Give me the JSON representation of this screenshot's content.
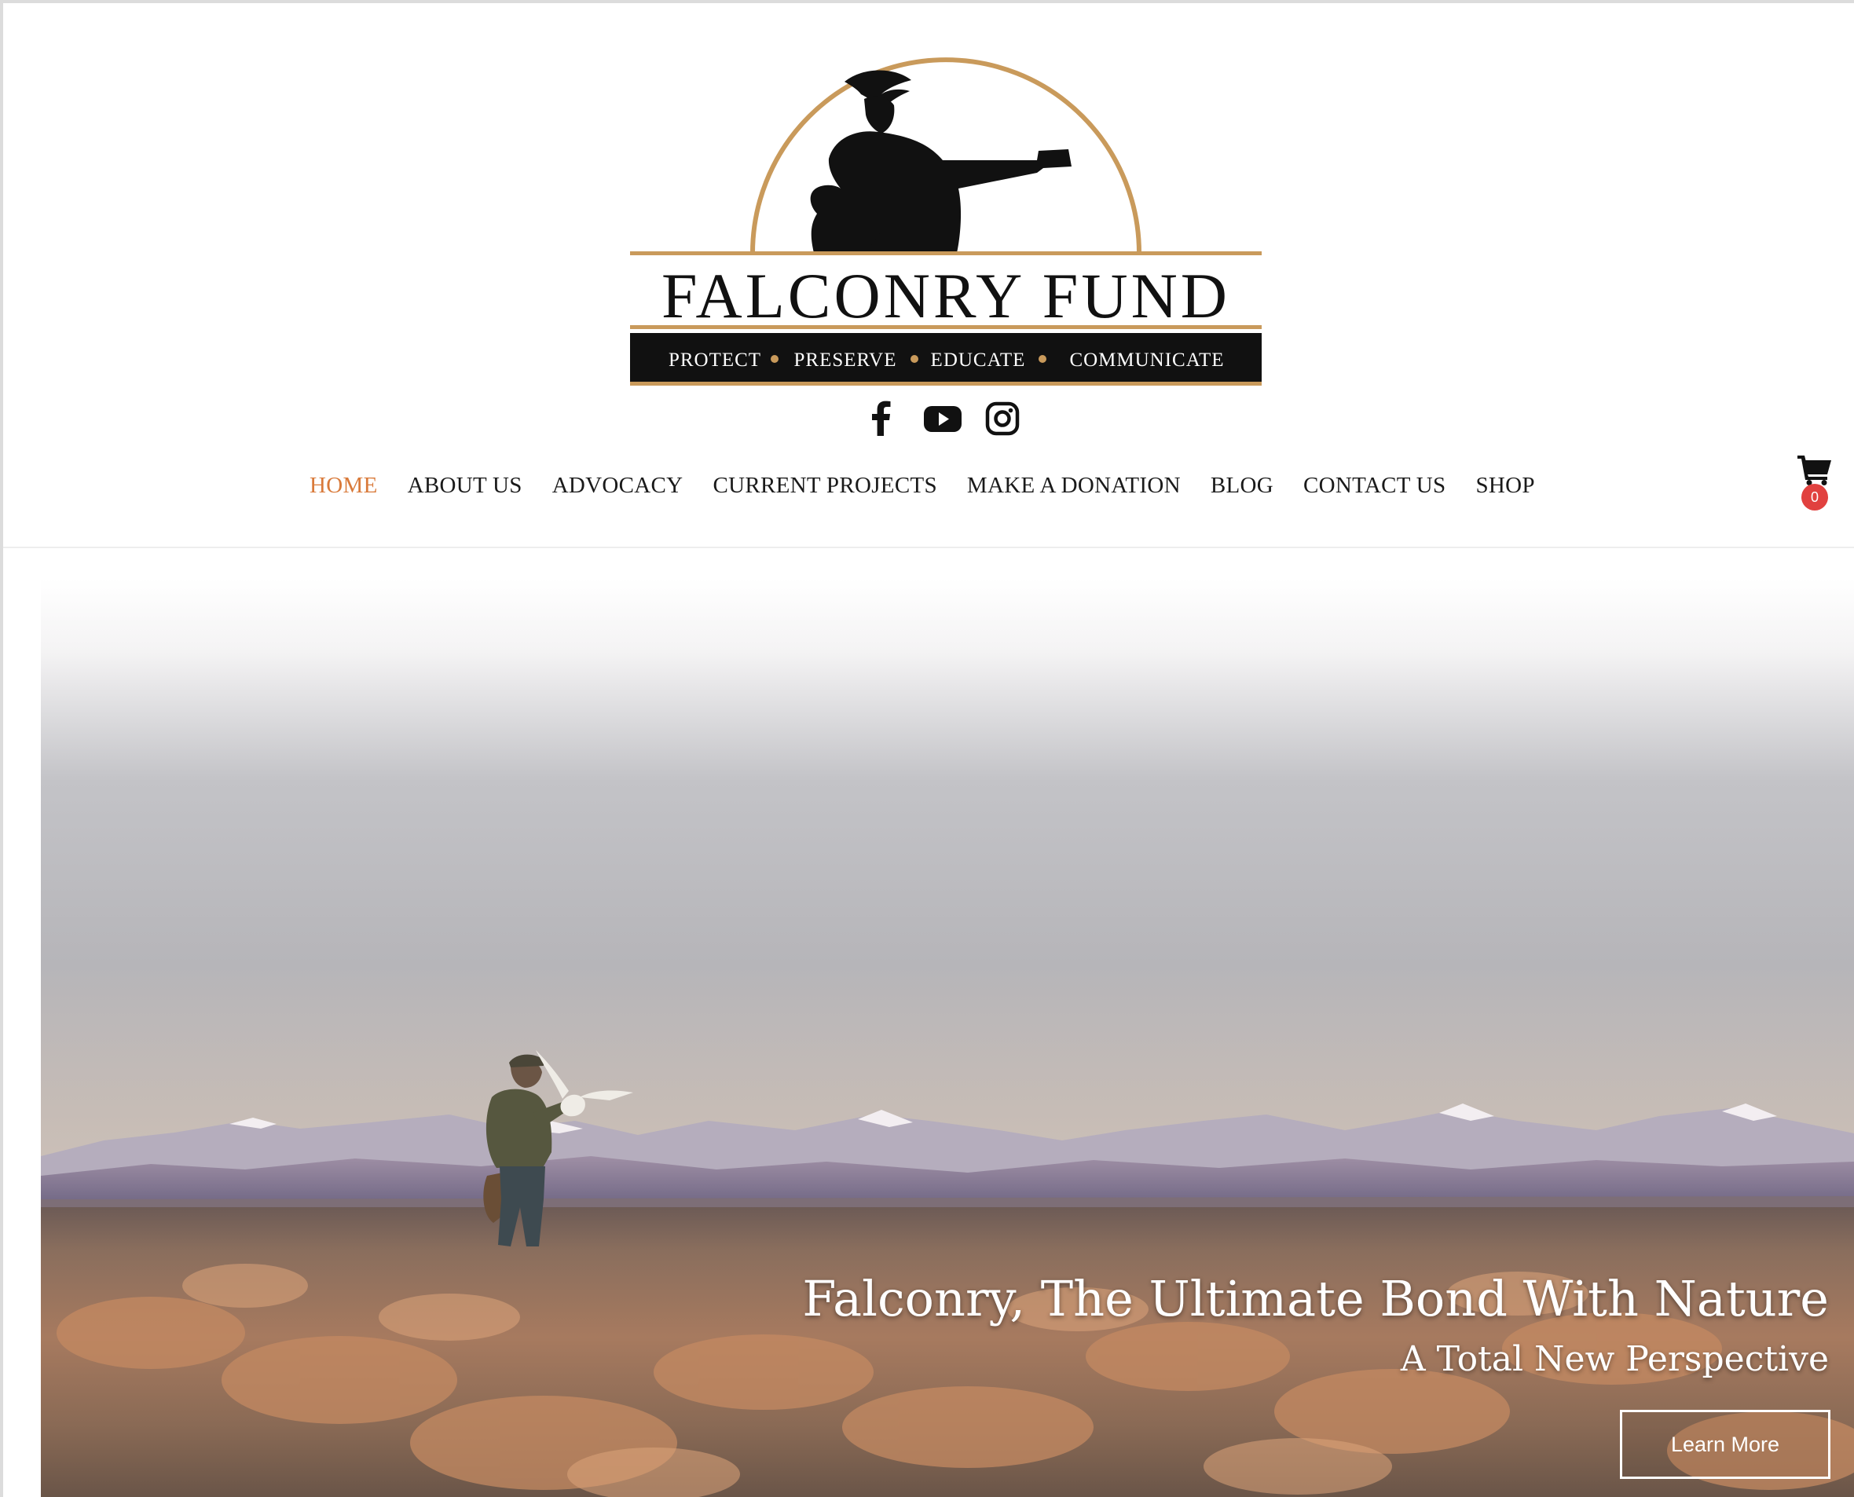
{
  "brand": {
    "name": "FALCONRY FUND",
    "tagline_items": [
      "PROTECT",
      "PRESERVE",
      "EDUCATE",
      "COMMUNICATE"
    ],
    "gold": "#c99a5b",
    "dark": "#111111"
  },
  "social": [
    {
      "name": "facebook",
      "icon": "facebook-icon"
    },
    {
      "name": "youtube",
      "icon": "youtube-icon"
    },
    {
      "name": "instagram",
      "icon": "instagram-icon"
    }
  ],
  "nav": {
    "items": [
      {
        "label": "HOME",
        "active": true
      },
      {
        "label": "ABOUT US"
      },
      {
        "label": "ADVOCACY"
      },
      {
        "label": "CURRENT PROJECTS"
      },
      {
        "label": "MAKE A DONATION"
      },
      {
        "label": "BLOG"
      },
      {
        "label": "CONTACT US"
      },
      {
        "label": "SHOP"
      }
    ],
    "active_color": "#d97a3a"
  },
  "cart": {
    "icon": "shopping-cart-icon",
    "count": "0",
    "badge_color": "#e1413f"
  },
  "hero": {
    "title": "Falconry, The Ultimate Bond With Nature",
    "subtitle": "A Total New Perspective",
    "button_label": "Learn More"
  }
}
